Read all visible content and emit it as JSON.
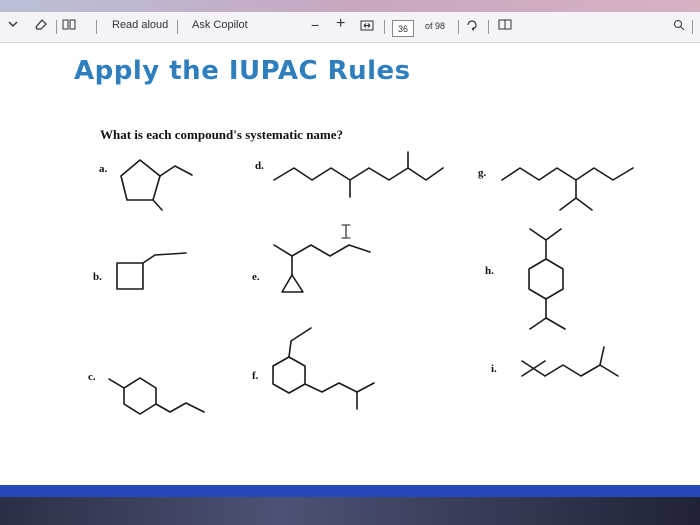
{
  "toolbar": {
    "read_aloud": "Read aloud",
    "ask_copilot": "Ask Copilot",
    "minus": "−",
    "plus": "+",
    "page_number": "36",
    "page_total": "of 98"
  },
  "document": {
    "title": "Apply the IUPAC Rules",
    "question": "What is each compound's systematic name?",
    "labels": {
      "a": "a.",
      "b": "b.",
      "c": "c.",
      "d": "d.",
      "e": "e.",
      "f": "f.",
      "g": "g.",
      "h": "h.",
      "i": "i."
    }
  },
  "colors": {
    "title": "#2f7fbf",
    "bottom_band": "#2748b8"
  }
}
